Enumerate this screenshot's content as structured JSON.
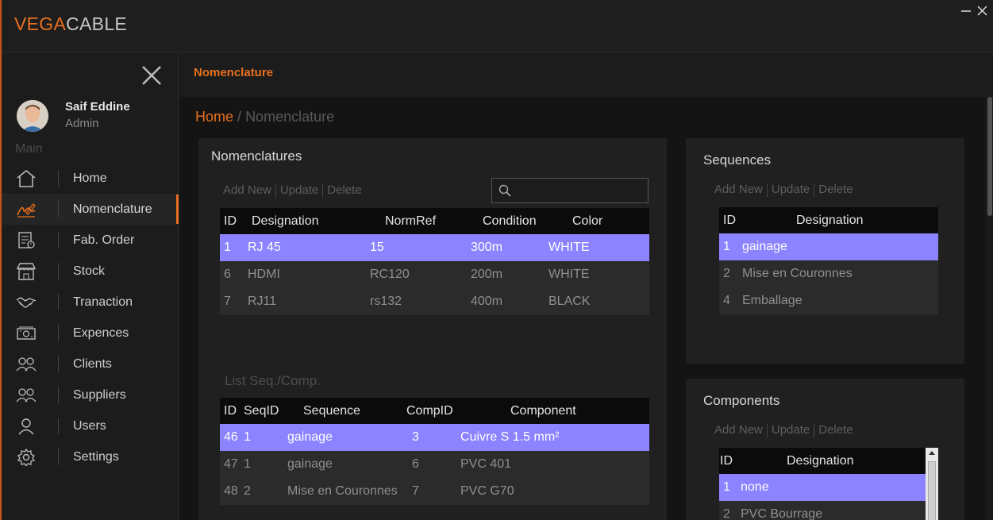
{
  "app": {
    "logo_part1": "VEGA",
    "logo_part2": "CABLE"
  },
  "user": {
    "name": "Saif Eddine",
    "role": "Admin"
  },
  "sidebar": {
    "section": "Main",
    "items": [
      {
        "label": "Home",
        "icon": "home-icon"
      },
      {
        "label": "Nomenclature",
        "icon": "signature-icon"
      },
      {
        "label": "Fab. Order",
        "icon": "order-icon"
      },
      {
        "label": "Stock",
        "icon": "store-icon"
      },
      {
        "label": "Tranaction",
        "icon": "handshake-icon"
      },
      {
        "label": "Expences",
        "icon": "money-icon"
      },
      {
        "label": "Clients",
        "icon": "users-icon"
      },
      {
        "label": "Suppliers",
        "icon": "users-icon"
      },
      {
        "label": "Users",
        "icon": "user-icon"
      },
      {
        "label": "Settings",
        "icon": "gear-icon"
      }
    ]
  },
  "header": {
    "title": "Nomenclature"
  },
  "breadcrumb": {
    "home": "Home",
    "sep": "/",
    "current": "Nomenclature"
  },
  "actions": {
    "add": "Add New",
    "update": "Update",
    "delete": "Delete"
  },
  "nomenclatures": {
    "title": "Nomenclatures",
    "search_placeholder": "",
    "columns": [
      "ID",
      "Designation",
      "NormRef",
      "Condition",
      "Color"
    ],
    "rows": [
      [
        "1",
        "RJ 45",
        "15",
        "300m",
        "WHITE"
      ],
      [
        "6",
        "HDMI",
        "RC120",
        "200m",
        "WHITE"
      ],
      [
        "7",
        "RJ11",
        "rs132",
        "400m",
        "BLACK"
      ]
    ]
  },
  "seqcomp": {
    "title": "List Seq./Comp.",
    "columns": [
      "ID",
      "SeqID",
      "Sequence",
      "CompID",
      "Component"
    ],
    "rows": [
      [
        "46",
        "1",
        "gainage",
        "3",
        "Cuivre S 1.5 mm²"
      ],
      [
        "47",
        "1",
        "gainage",
        "6",
        "PVC 401"
      ],
      [
        "48",
        "2",
        "Mise en Couronnes",
        "7",
        "PVC G70"
      ]
    ]
  },
  "sequences": {
    "title": "Sequences",
    "columns": [
      "ID",
      "Designation"
    ],
    "rows": [
      [
        "1",
        "gainage"
      ],
      [
        "2",
        "Mise en Couronnes"
      ],
      [
        "4",
        "Emballage"
      ]
    ]
  },
  "components": {
    "title": "Components",
    "columns": [
      "ID",
      "Designation"
    ],
    "rows": [
      [
        "1",
        "none"
      ],
      [
        "2",
        "PVC Bourrage"
      ]
    ]
  },
  "colors": {
    "accent": "#e8701e",
    "selection": "#8b83ff"
  }
}
